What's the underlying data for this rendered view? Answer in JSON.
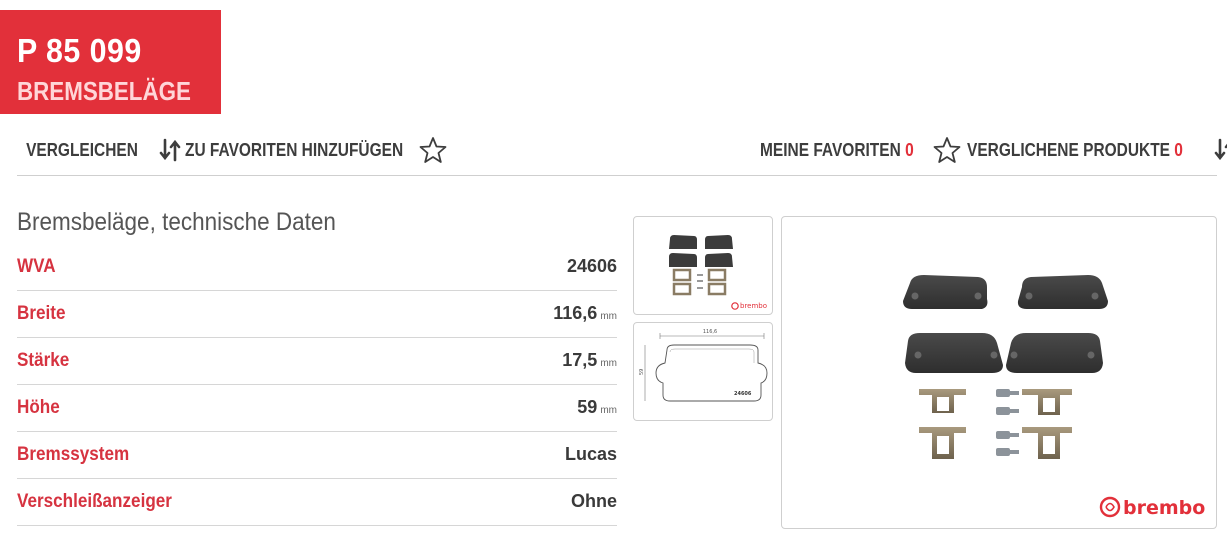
{
  "product": {
    "code": "P 85 099",
    "type": "BREMSBELÄGE"
  },
  "toolbar": {
    "compare_label": "VERGLEICHEN",
    "add_favorites_label": "ZU FAVORITEN HINZUFÜGEN",
    "my_favorites_label": "MEINE FAVORITEN",
    "my_favorites_count": "0",
    "compared_products_label": "VERGLICHENE PRODUKTE",
    "compared_products_count": "0"
  },
  "specs": {
    "title": "Bremsbeläge, technische Daten",
    "rows": [
      {
        "label": "WVA",
        "value": "24606",
        "unit": ""
      },
      {
        "label": "Breite",
        "value": "116,6",
        "unit": "mm"
      },
      {
        "label": "Stärke",
        "value": "17,5",
        "unit": "mm"
      },
      {
        "label": "Höhe",
        "value": "59",
        "unit": "mm"
      },
      {
        "label": "Bremssystem",
        "value": "Lucas",
        "unit": ""
      },
      {
        "label": "Verschleißanzeiger",
        "value": "Ohne",
        "unit": ""
      }
    ]
  },
  "drawing": {
    "width_label": "116,6",
    "height_label": "59",
    "wva_label": "24606"
  },
  "brand": {
    "logo_text": "brembo"
  },
  "colors": {
    "accent": "#e2303a",
    "label_red": "#d63340",
    "text": "#3a3a3a",
    "divider": "#cfcfcf",
    "pad_dark": "#3b3b3b",
    "clip_metal": "#8a7c64"
  }
}
